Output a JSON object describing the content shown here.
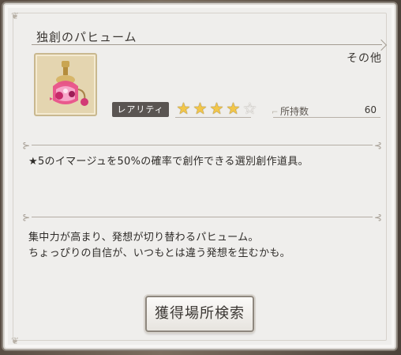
{
  "item": {
    "name": "独創のパヒューム",
    "category": "その他",
    "rarity_label": "レアリティ",
    "rarity": {
      "filled": 4,
      "max": 5
    },
    "owned_label": "所持数",
    "owned_count": "60",
    "effect": "★5のイマージュを50%の確率で創作できる選別創作道具。",
    "flavor_line1": "集中力が高まり、発想が切り替わるパヒューム。",
    "flavor_line2": "ちょっぴりの自信が、いつもとは違う発想を生むかも。"
  },
  "buttons": {
    "search_label": "獲得場所検索"
  },
  "icons": {
    "item_icon": "perfume-bottle-icon",
    "star_filled": "star-filled-icon",
    "star_empty": "star-empty-icon"
  },
  "colors": {
    "star_filled": "#f2c64a",
    "rarity_bg": "#5a5552",
    "panel_bg": "#efeeec"
  }
}
